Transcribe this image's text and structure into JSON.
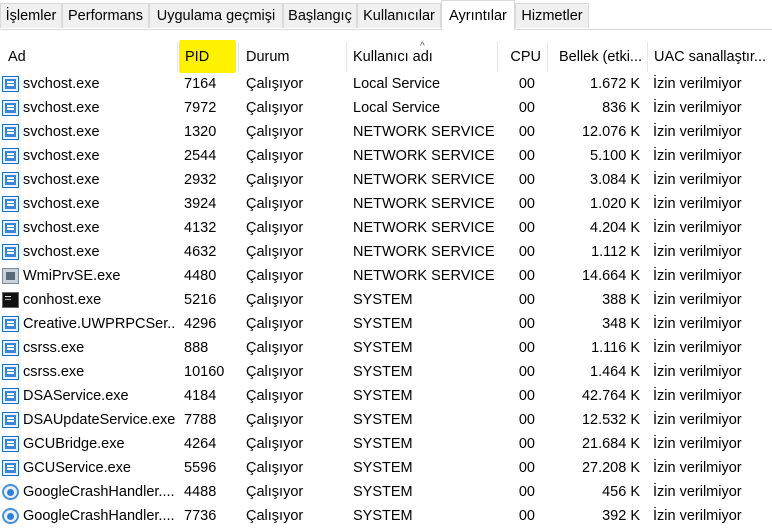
{
  "tabs": [
    "İşlemler",
    "Performans",
    "Uygulama geçmişi",
    "Başlangıç",
    "Kullanıcılar",
    "Ayrıntılar",
    "Hizmetler"
  ],
  "active_tab": "Ayrıntılar",
  "columns": {
    "name": "Ad",
    "pid": "PID",
    "status": "Durum",
    "user": "Kullanıcı adı",
    "cpu": "CPU",
    "memory": "Bellek (etki...",
    "uac": "UAC sanallaştır..."
  },
  "sorted_column": "Kullanıcı adı",
  "highlight_color": "#fff200",
  "rows": [
    {
      "name": "svchost.exe",
      "pid": "7164",
      "status": "Çalışıyor",
      "user": "Local Service",
      "cpu": "00",
      "memory": "1.672 K",
      "uac": "İzin verilmiyor",
      "icon": "service-icon"
    },
    {
      "name": "svchost.exe",
      "pid": "7972",
      "status": "Çalışıyor",
      "user": "Local Service",
      "cpu": "00",
      "memory": "836 K",
      "uac": "İzin verilmiyor",
      "icon": "service-icon"
    },
    {
      "name": "svchost.exe",
      "pid": "1320",
      "status": "Çalışıyor",
      "user": "NETWORK SERVICE",
      "cpu": "00",
      "memory": "12.076 K",
      "uac": "İzin verilmiyor",
      "icon": "service-icon"
    },
    {
      "name": "svchost.exe",
      "pid": "2544",
      "status": "Çalışıyor",
      "user": "NETWORK SERVICE",
      "cpu": "00",
      "memory": "5.100 K",
      "uac": "İzin verilmiyor",
      "icon": "service-icon"
    },
    {
      "name": "svchost.exe",
      "pid": "2932",
      "status": "Çalışıyor",
      "user": "NETWORK SERVICE",
      "cpu": "00",
      "memory": "3.084 K",
      "uac": "İzin verilmiyor",
      "icon": "service-icon"
    },
    {
      "name": "svchost.exe",
      "pid": "3924",
      "status": "Çalışıyor",
      "user": "NETWORK SERVICE",
      "cpu": "00",
      "memory": "1.020 K",
      "uac": "İzin verilmiyor",
      "icon": "service-icon"
    },
    {
      "name": "svchost.exe",
      "pid": "4132",
      "status": "Çalışıyor",
      "user": "NETWORK SERVICE",
      "cpu": "00",
      "memory": "4.204 K",
      "uac": "İzin verilmiyor",
      "icon": "service-icon"
    },
    {
      "name": "svchost.exe",
      "pid": "4632",
      "status": "Çalışıyor",
      "user": "NETWORK SERVICE",
      "cpu": "00",
      "memory": "1.112 K",
      "uac": "İzin verilmiyor",
      "icon": "service-icon"
    },
    {
      "name": "WmiPrvSE.exe",
      "pid": "4480",
      "status": "Çalışıyor",
      "user": "NETWORK SERVICE",
      "cpu": "00",
      "memory": "14.664 K",
      "uac": "İzin verilmiyor",
      "icon": "wmi-icon"
    },
    {
      "name": "conhost.exe",
      "pid": "5216",
      "status": "Çalışıyor",
      "user": "SYSTEM",
      "cpu": "00",
      "memory": "388 K",
      "uac": "İzin verilmiyor",
      "icon": "console-icon"
    },
    {
      "name": "Creative.UWPRPCSer...",
      "pid": "4296",
      "status": "Çalışıyor",
      "user": "SYSTEM",
      "cpu": "00",
      "memory": "348 K",
      "uac": "İzin verilmiyor",
      "icon": "service-icon"
    },
    {
      "name": "csrss.exe",
      "pid": "888",
      "status": "Çalışıyor",
      "user": "SYSTEM",
      "cpu": "00",
      "memory": "1.116 K",
      "uac": "İzin verilmiyor",
      "icon": "service-icon"
    },
    {
      "name": "csrss.exe",
      "pid": "10160",
      "status": "Çalışıyor",
      "user": "SYSTEM",
      "cpu": "00",
      "memory": "1.464 K",
      "uac": "İzin verilmiyor",
      "icon": "service-icon"
    },
    {
      "name": "DSAService.exe",
      "pid": "4184",
      "status": "Çalışıyor",
      "user": "SYSTEM",
      "cpu": "00",
      "memory": "42.764 K",
      "uac": "İzin verilmiyor",
      "icon": "service-icon"
    },
    {
      "name": "DSAUpdateService.exe",
      "pid": "7788",
      "status": "Çalışıyor",
      "user": "SYSTEM",
      "cpu": "00",
      "memory": "12.532 K",
      "uac": "İzin verilmiyor",
      "icon": "service-icon"
    },
    {
      "name": "GCUBridge.exe",
      "pid": "4264",
      "status": "Çalışıyor",
      "user": "SYSTEM",
      "cpu": "00",
      "memory": "21.684 K",
      "uac": "İzin verilmiyor",
      "icon": "service-icon"
    },
    {
      "name": "GCUService.exe",
      "pid": "5596",
      "status": "Çalışıyor",
      "user": "SYSTEM",
      "cpu": "00",
      "memory": "27.208 K",
      "uac": "İzin verilmiyor",
      "icon": "service-icon"
    },
    {
      "name": "GoogleCrashHandler....",
      "pid": "4488",
      "status": "Çalışıyor",
      "user": "SYSTEM",
      "cpu": "00",
      "memory": "456 K",
      "uac": "İzin verilmiyor",
      "icon": "google-crash-icon"
    },
    {
      "name": "GoogleCrashHandler....",
      "pid": "7736",
      "status": "Çalışıyor",
      "user": "SYSTEM",
      "cpu": "00",
      "memory": "392 K",
      "uac": "İzin verilmiyor",
      "icon": "google-crash-icon"
    }
  ]
}
